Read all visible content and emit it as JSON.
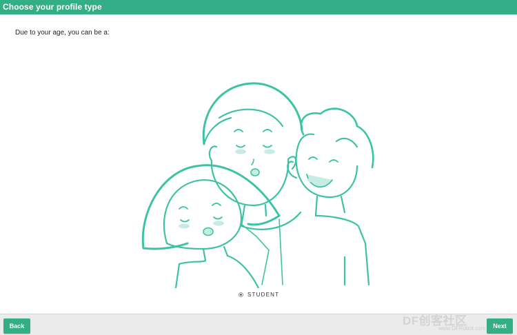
{
  "header": {
    "title": "Choose your profile type"
  },
  "main": {
    "prompt": "Due to your age, you can be a:",
    "options": [
      {
        "label": "STUDENT",
        "selected": true
      }
    ]
  },
  "footer": {
    "back_label": "Back",
    "next_label": "Next"
  },
  "watermark": {
    "text": "DF创客社区",
    "sub": "www.DFRobot.com.cn"
  },
  "colors": {
    "accent": "#34ae86",
    "illustration_line": "#3cc2a4",
    "blush": "#c6ece3"
  }
}
